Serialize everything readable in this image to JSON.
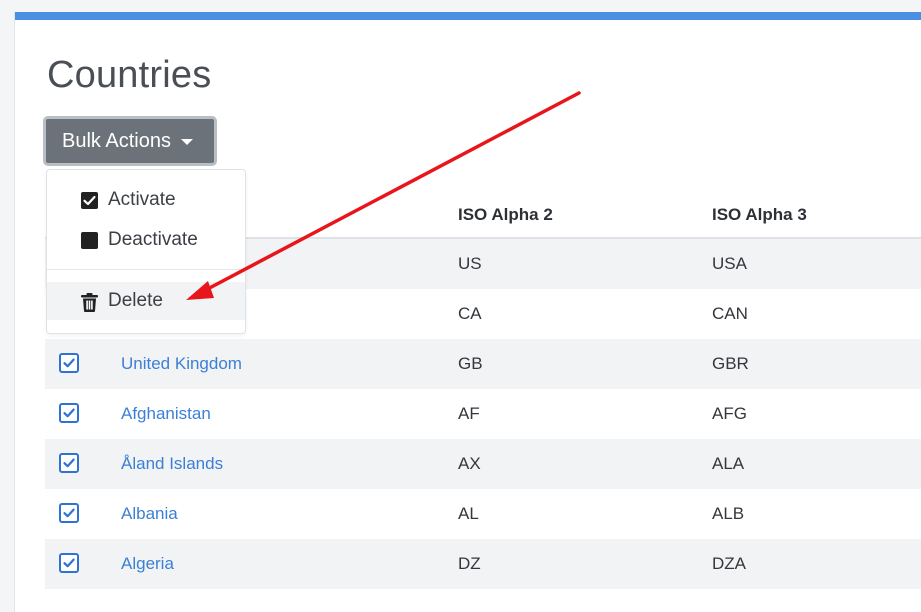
{
  "page": {
    "title": "Countries"
  },
  "toolbar": {
    "bulk_actions_label": "Bulk Actions"
  },
  "dropdown": {
    "items": [
      {
        "label": "Activate",
        "icon": "checked-square-icon"
      },
      {
        "label": "Deactivate",
        "icon": "filled-square-icon"
      },
      {
        "label": "Delete",
        "icon": "trash-icon"
      }
    ]
  },
  "table": {
    "columns": [
      "ISO Alpha 2",
      "ISO Alpha 3"
    ],
    "rows": [
      {
        "name": "",
        "alpha2": "US",
        "alpha3": "USA",
        "checked": true
      },
      {
        "name": "",
        "alpha2": "CA",
        "alpha3": "CAN",
        "checked": true
      },
      {
        "name": "United Kingdom",
        "alpha2": "GB",
        "alpha3": "GBR",
        "checked": true
      },
      {
        "name": "Afghanistan",
        "alpha2": "AF",
        "alpha3": "AFG",
        "checked": true
      },
      {
        "name": "Åland Islands",
        "alpha2": "AX",
        "alpha3": "ALA",
        "checked": true
      },
      {
        "name": "Albania",
        "alpha2": "AL",
        "alpha3": "ALB",
        "checked": true
      },
      {
        "name": "Algeria",
        "alpha2": "DZ",
        "alpha3": "DZA",
        "checked": true
      }
    ]
  },
  "colors": {
    "accent": "#4a90e2",
    "link": "#3b7fd6",
    "checkbox": "#2f73d2",
    "button": "#6b727a",
    "annotation_arrow": "#e8161b"
  }
}
